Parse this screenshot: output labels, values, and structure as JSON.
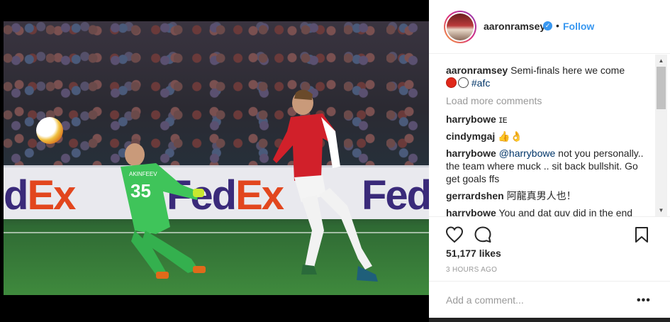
{
  "post": {
    "username": "aaronramsey",
    "verified_mark": "✓",
    "dot": "•",
    "follow_label": "Follow",
    "caption_user": "aaronramsey",
    "caption_text": "Semi-finals here we come",
    "caption_hashtag": "#afc",
    "load_more": "Load more comments",
    "likes": "51,177 likes",
    "time": "3 HOURS AGO",
    "add_comment_placeholder": "Add a comment...",
    "more_options": "•••"
  },
  "comments": [
    {
      "user": "harrybowe",
      "mention": "",
      "text": "ɪᴇ"
    },
    {
      "user": "cindymgaj",
      "mention": "",
      "text": "👍👌"
    },
    {
      "user": "harrybowe",
      "mention": "@harrybowe",
      "text": " not you personally.. the team where muck .. sit back bullshit. Go get goals ffs"
    },
    {
      "user": "gerrardshen",
      "mention": "",
      "text": "阿龍真男人也！"
    },
    {
      "user": "harrybowe",
      "mention": "",
      "text": "You and dat guy did in the end"
    }
  ],
  "photo": {
    "ad_text_1": "dEx",
    "ad_text_2": "FedEx",
    "ad_text_3": "Fed",
    "keeper_number": "35",
    "keeper_name": "AKINFEEV"
  },
  "icons": {
    "like": "heart-icon",
    "comment": "comment-icon",
    "save": "bookmark-icon",
    "verified": "verified-badge-icon"
  },
  "colors": {
    "link_blue": "#3897f0",
    "text": "#262626",
    "muted": "#999999"
  }
}
